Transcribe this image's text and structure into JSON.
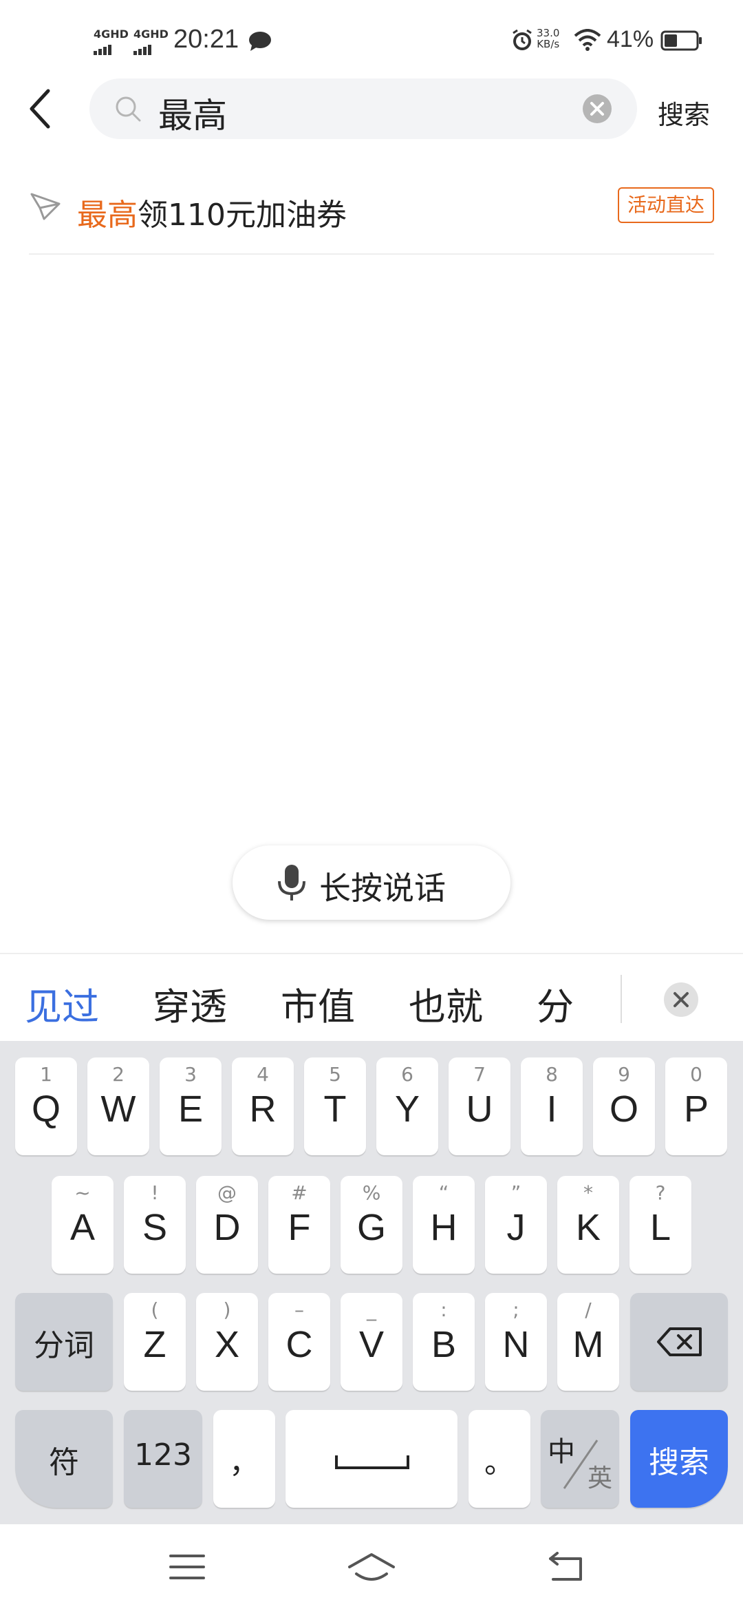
{
  "status_bar": {
    "sim1_label": "4GHD",
    "sim2_label": "4GHD",
    "time": "20:21",
    "net_speed_value": "33.0",
    "net_speed_unit": "KB/s",
    "battery_percent": "41%",
    "battery_level": 0.41
  },
  "search": {
    "query": "最高",
    "search_button_label": "搜索"
  },
  "suggestion": {
    "highlight": "最高",
    "rest": "领110元加油券",
    "badge": "活动直达"
  },
  "voice": {
    "label": "长按说话"
  },
  "candidates": [
    "见过",
    "穿透",
    "市值",
    "也就",
    "分"
  ],
  "keyboard": {
    "row1": [
      {
        "hint": "1",
        "key": "Q"
      },
      {
        "hint": "2",
        "key": "W"
      },
      {
        "hint": "3",
        "key": "E"
      },
      {
        "hint": "4",
        "key": "R"
      },
      {
        "hint": "5",
        "key": "T"
      },
      {
        "hint": "6",
        "key": "Y"
      },
      {
        "hint": "7",
        "key": "U"
      },
      {
        "hint": "8",
        "key": "I"
      },
      {
        "hint": "9",
        "key": "O"
      },
      {
        "hint": "0",
        "key": "P"
      }
    ],
    "row2": [
      {
        "hint": "~",
        "key": "A"
      },
      {
        "hint": "!",
        "key": "S"
      },
      {
        "hint": "@",
        "key": "D"
      },
      {
        "hint": "#",
        "key": "F"
      },
      {
        "hint": "%",
        "key": "G"
      },
      {
        "hint": "“",
        "key": "H"
      },
      {
        "hint": "”",
        "key": "J"
      },
      {
        "hint": "*",
        "key": "K"
      },
      {
        "hint": "?",
        "key": "L"
      }
    ],
    "row3": [
      {
        "hint": "(",
        "key": "Z"
      },
      {
        "hint": ")",
        "key": "X"
      },
      {
        "hint": "–",
        "key": "C"
      },
      {
        "hint": "_",
        "key": "V"
      },
      {
        "hint": ":",
        "key": "B"
      },
      {
        "hint": ";",
        "key": "N"
      },
      {
        "hint": "/",
        "key": "M"
      }
    ],
    "segment_label": "分词",
    "symbols_label": "符",
    "numbers_label": "123",
    "comma_label": "，",
    "period_label": "。",
    "lang_zh": "中",
    "lang_en": "英",
    "search_label": "搜索"
  },
  "colors": {
    "accent_blue": "#3d73f0",
    "highlight_orange": "#e8691c",
    "candidate_blue": "#3b6fe0"
  }
}
